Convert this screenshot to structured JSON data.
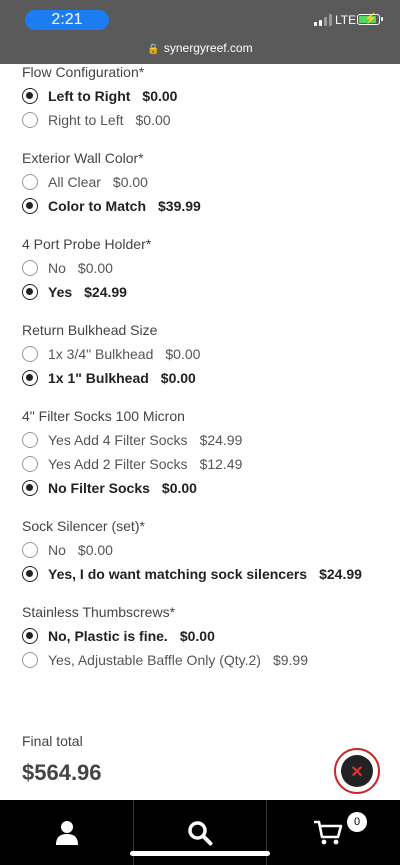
{
  "status_bar": {
    "time": "2:21",
    "network": "LTE",
    "url": "synergyreef.com"
  },
  "groups": [
    {
      "label": "Flow Configuration*",
      "options": [
        {
          "label": "Left to Right",
          "price": "$0.00",
          "selected": true
        },
        {
          "label": "Right to Left",
          "price": "$0.00",
          "selected": false
        }
      ]
    },
    {
      "label": "Exterior Wall Color*",
      "options": [
        {
          "label": "All Clear",
          "price": "$0.00",
          "selected": false
        },
        {
          "label": "Color to Match",
          "price": "$39.99",
          "selected": true
        }
      ]
    },
    {
      "label": "4 Port Probe Holder*",
      "options": [
        {
          "label": "No",
          "price": "$0.00",
          "selected": false
        },
        {
          "label": "Yes",
          "price": "$24.99",
          "selected": true
        }
      ]
    },
    {
      "label": "Return Bulkhead Size",
      "options": [
        {
          "label": "1x 3/4\" Bulkhead",
          "price": "$0.00",
          "selected": false
        },
        {
          "label": "1x 1\" Bulkhead",
          "price": "$0.00",
          "selected": true
        }
      ]
    },
    {
      "label": "4\" Filter Socks 100 Micron",
      "options": [
        {
          "label": "Yes Add 4 Filter Socks",
          "price": "$24.99",
          "selected": false
        },
        {
          "label": "Yes Add 2 Filter Socks",
          "price": "$12.49",
          "selected": false
        },
        {
          "label": "No Filter Socks",
          "price": "$0.00",
          "selected": true
        }
      ]
    },
    {
      "label": "Sock Silencer (set)*",
      "options": [
        {
          "label": "No",
          "price": "$0.00",
          "selected": false
        },
        {
          "label": "Yes, I do want matching sock silencers",
          "price": "$24.99",
          "selected": true
        }
      ]
    },
    {
      "label": "Stainless Thumbscrews*",
      "options": [
        {
          "label": "No, Plastic is fine.",
          "price": "$0.00",
          "selected": true
        },
        {
          "label": "Yes, Adjustable Baffle Only (Qty.2)",
          "price": "$9.99",
          "selected": false
        }
      ]
    }
  ],
  "final_total": {
    "label": "Final total",
    "value": "$564.96"
  },
  "bottom_nav": {
    "cart_count": "0",
    "icons": [
      "user-icon",
      "search-icon",
      "cart-icon"
    ]
  }
}
